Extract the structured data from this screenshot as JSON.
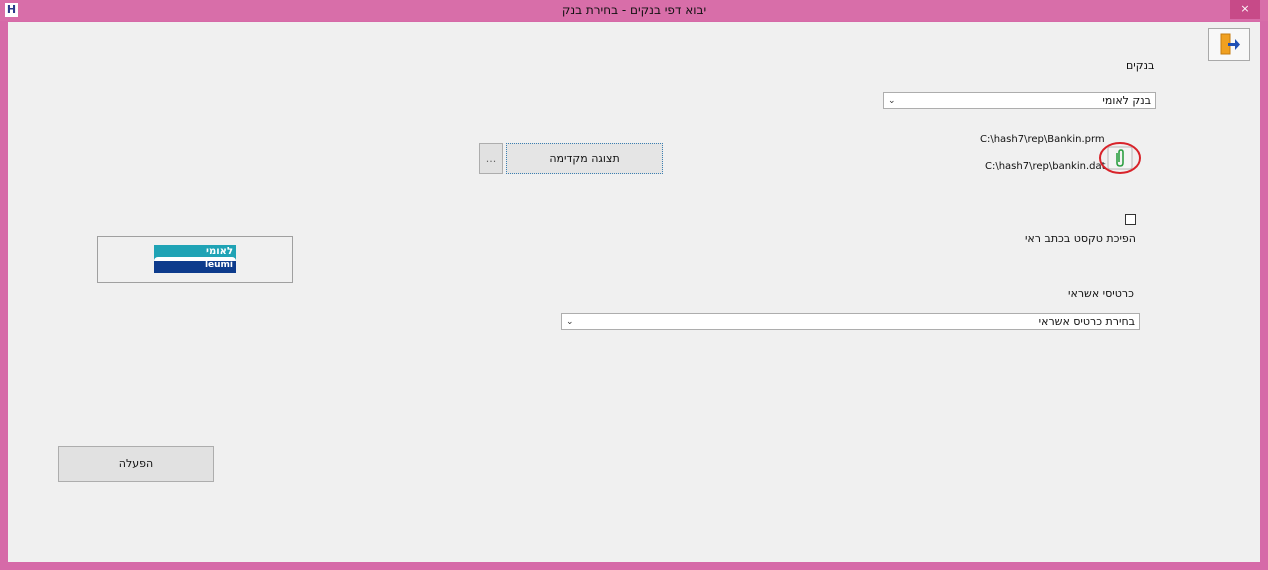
{
  "window": {
    "title": "יבוא דפי בנקים - בחירת בנק",
    "app_icon": "H",
    "close_glyph": "×"
  },
  "exit_button": {
    "icon": "exit-door-arrow-icon"
  },
  "banks": {
    "label": "בנקים",
    "selected": "בנק לאומי",
    "arrow": "⌄"
  },
  "files": {
    "prm_path": "C:\\hash7\\rep\\Bankin.prm",
    "dat_path": "C:\\hash7\\rep\\bankin.dat",
    "attach_icon": "paperclip-icon"
  },
  "preview": {
    "label": "תצוגה מקדימה",
    "browse_label": "..."
  },
  "reverse_text": {
    "label": "הפיכת טקסט בכתב ראי",
    "checked": false
  },
  "logo": {
    "hebrew": "לאומי",
    "latin": "leumi"
  },
  "credit_cards": {
    "label": "כרטיסי אשראי",
    "selected": "בחירת כרטיס אשראי",
    "arrow": "⌄"
  },
  "run": {
    "label": "הפעלה"
  },
  "colors": {
    "titlebar": "#d86ea9",
    "close": "#c74a88",
    "client": "#f0f0f0",
    "highlight_ring": "#d8232a",
    "leumi_blue": "#0d3b8c",
    "leumi_teal": "#1fa3b5"
  }
}
